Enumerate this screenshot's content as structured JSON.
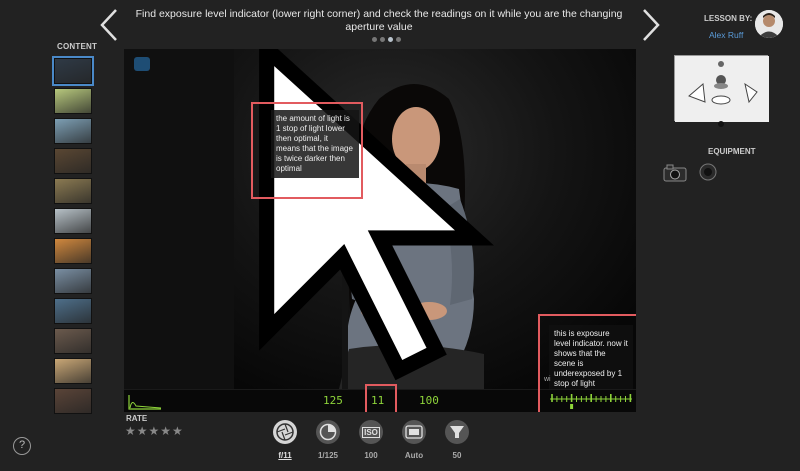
{
  "header": {
    "instruction": "Find exposure level indicator (lower right corner) and check the readings on it while you are the changing aperture value",
    "pager_dots": 4,
    "active_dot": 2
  },
  "sidebar": {
    "title": "CONTENT",
    "thumbnails": [
      {
        "name": "woman-portrait",
        "color": "#2f3a46"
      },
      {
        "name": "green-apples",
        "color": "#b7c87d"
      },
      {
        "name": "person-on-shore",
        "color": "#7d9fb4"
      },
      {
        "name": "vinyl-records",
        "color": "#5a4733"
      },
      {
        "name": "autumn-lake",
        "color": "#8b7a52"
      },
      {
        "name": "woman-window",
        "color": "#b7c1c7"
      },
      {
        "name": "colorful-jars",
        "color": "#d0883e"
      },
      {
        "name": "city-skyline",
        "color": "#7a8fa3"
      },
      {
        "name": "mountain-lake",
        "color": "#4e6f8a"
      },
      {
        "name": "woman-laptop",
        "color": "#6b5a4d"
      },
      {
        "name": "sunset-sea",
        "color": "#c9a776"
      },
      {
        "name": "woman-dark-hair",
        "color": "#5a4438"
      }
    ]
  },
  "viewer": {
    "notes": {
      "left": "the amount of light is 1 stop of light lower then optimal, it means that the image is twice darker then optimal",
      "right": "this is exposure level indicator. now it shows that the scene is underexposed by 1 stop of light"
    },
    "watermark": "wi",
    "readouts": {
      "shutter": "125",
      "aperture": "11",
      "iso": "100"
    },
    "exposure_offset_stops": -1
  },
  "lesson": {
    "label": "LESSON BY:",
    "author": "Alex Ruff",
    "equipment_label": "EQUIPMENT"
  },
  "rating": {
    "label": "RATE",
    "stars": "★★★★★"
  },
  "help": {
    "label": "?"
  },
  "controls": [
    {
      "name": "aperture",
      "icon": "aperture-icon",
      "label": "f/11",
      "active": true
    },
    {
      "name": "shutter",
      "icon": "shutter-icon",
      "label": "1/125",
      "active": false
    },
    {
      "name": "iso",
      "icon": "iso-icon",
      "label": "100",
      "active": false,
      "icon_text": "ISO"
    },
    {
      "name": "white-balance",
      "icon": "white-balance-icon",
      "label": "Auto",
      "active": false
    },
    {
      "name": "flash-power",
      "icon": "flash-power-icon",
      "label": "50",
      "active": false
    }
  ],
  "colors": {
    "accent_blue": "#5a9bd8",
    "highlight_red": "#e25b5f",
    "readout_green": "#8ed43a"
  }
}
